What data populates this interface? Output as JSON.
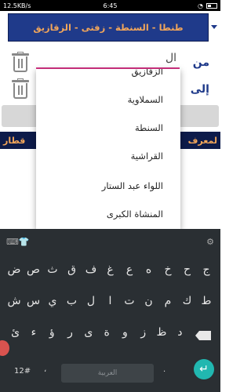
{
  "status": {
    "left": "12.5KB/s",
    "time": "6:45"
  },
  "app": {
    "title": "طنطا - السنطة - زفتى - الزقازيق"
  },
  "form": {
    "from_label": "من",
    "to_label": "إلى",
    "from_value": "ال",
    "bar_text_left": "قطار",
    "bar_text_right": "لمعرف"
  },
  "suggestions": [
    "الزقازيق",
    "السملاوية",
    "السنطة",
    "القراشية",
    "اللواء عبد الستار",
    "المنشاة الكبرى"
  ],
  "keyboard": {
    "row1": [
      "ض",
      "ص",
      "ث",
      "ق",
      "ف",
      "غ",
      "ع",
      "ه",
      "خ",
      "ح",
      "ج"
    ],
    "row2": [
      "ش",
      "س",
      "ي",
      "ب",
      "ل",
      "ا",
      "ت",
      "ن",
      "م",
      "ك",
      "ط"
    ],
    "row3": [
      "ئ",
      "ء",
      "ؤ",
      "ر",
      "ى",
      "ة",
      "و",
      "ز",
      "ظ",
      "د"
    ],
    "mode_label": "12#",
    "space_label": "العربية",
    "enter_symbol": "↵"
  }
}
